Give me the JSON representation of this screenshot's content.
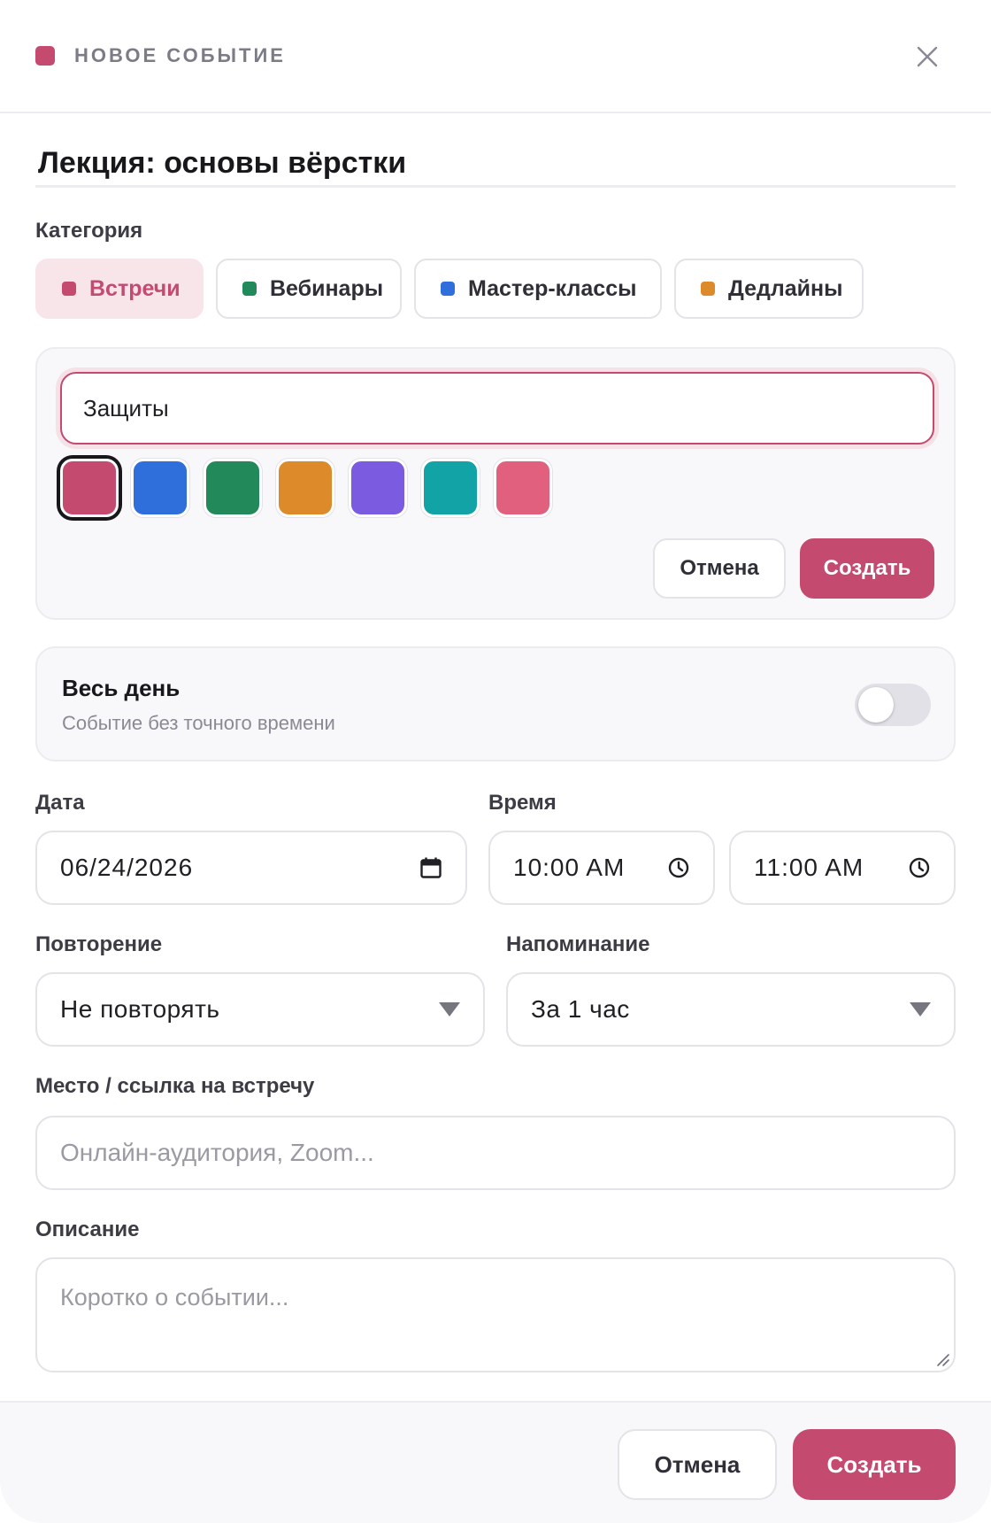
{
  "header": {
    "title": "НОВОЕ СОБЫТИЕ",
    "accent_color": "#c44a6f",
    "close_icon": "close-icon"
  },
  "event": {
    "title_value": "Лекция: основы вёрстки"
  },
  "category": {
    "label": "Категория",
    "items": [
      {
        "label": "Встречи",
        "color": "#c44a6f",
        "active": true
      },
      {
        "label": "Вебинары",
        "color": "#228a5a",
        "active": false
      },
      {
        "label": "Мастер-классы",
        "color": "#2f6fdc",
        "active": false
      },
      {
        "label": "Дедлайны",
        "color": "#dd8a2a",
        "active": false
      }
    ]
  },
  "new_category": {
    "input_value": "Защиты",
    "swatches": [
      "#c44a6f",
      "#2f6fdc",
      "#228a5a",
      "#dd8a2a",
      "#7b5ce0",
      "#12a3a6",
      "#e0607e"
    ],
    "selected_swatch": 0,
    "cancel_label": "Отмена",
    "create_label": "Создать"
  },
  "all_day": {
    "title": "Весь день",
    "subtitle": "Событие без точного времени",
    "enabled": false
  },
  "date": {
    "label": "Дата",
    "value": "06/24/2026",
    "icon": "calendar-icon"
  },
  "time": {
    "label": "Время",
    "start": "10:00 AM",
    "end": "11:00 AM",
    "icon": "clock-icon"
  },
  "repeat": {
    "label": "Повторение",
    "value": "Не повторять"
  },
  "reminder": {
    "label": "Напоминание",
    "value": "За 1 час"
  },
  "location": {
    "label": "Место / ссылка на встречу",
    "placeholder": "Онлайн-аудитория, Zoom..."
  },
  "description": {
    "label": "Описание",
    "placeholder": "Коротко о событии..."
  },
  "footer": {
    "cancel_label": "Отмена",
    "create_label": "Создать"
  }
}
